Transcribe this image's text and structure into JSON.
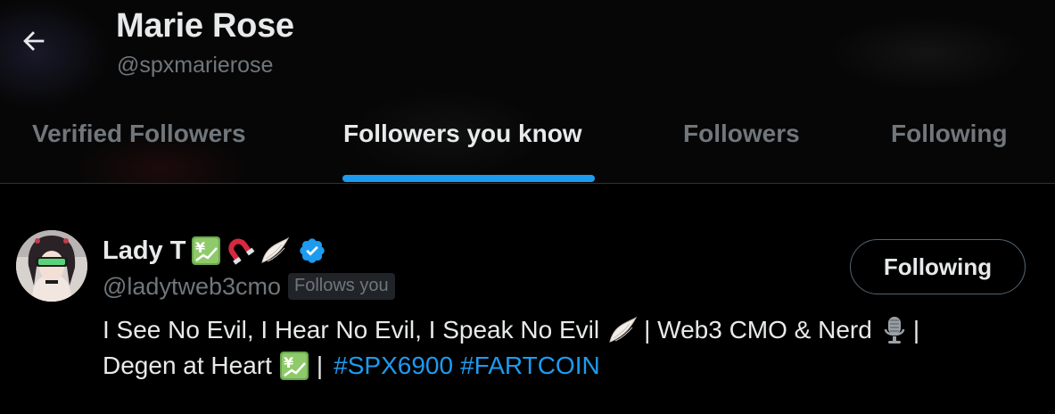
{
  "header": {
    "back_icon": "arrow-left-icon",
    "profile_name": "Marie Rose",
    "profile_handle": "@spxmarierose"
  },
  "tabs": [
    {
      "label": "Verified Followers",
      "active": false
    },
    {
      "label": "Followers you know",
      "active": true
    },
    {
      "label": "Followers",
      "active": false
    },
    {
      "label": "Following",
      "active": false
    }
  ],
  "accent_color": "#1d9bf0",
  "users": [
    {
      "name": "Lady T",
      "name_emojis": [
        "currency-exchange-icon",
        "magnet-icon",
        "wing-icon"
      ],
      "verified_icon": "verified-badge-icon",
      "handle": "@ladytweb3cmo",
      "follows_you_label": "Follows you",
      "follow_button_label": "Following",
      "bio": {
        "part1": "I See No Evil, I Hear No Evil, I Speak No Evil",
        "part2": "| Web3 CMO & Nerd",
        "part3": "|",
        "part4": "Degen at Heart",
        "part5": "|",
        "hashtags": [
          "#SPX6900",
          "#FARTCOIN"
        ]
      }
    }
  ]
}
